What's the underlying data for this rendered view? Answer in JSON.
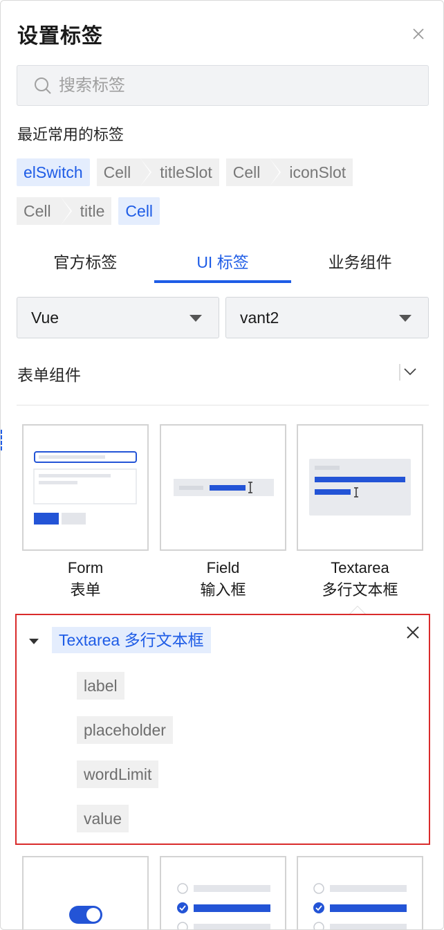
{
  "header": {
    "title": "设置标签"
  },
  "search": {
    "placeholder": "搜索标签"
  },
  "recent": {
    "title": "最近常用的标签",
    "row1": {
      "tag_a": "elSwitch",
      "pair_a": [
        "Cell",
        "titleSlot"
      ],
      "pair_b": [
        "Cell",
        "iconSlot"
      ]
    },
    "row2": {
      "pair_c": [
        "Cell",
        "title"
      ],
      "tag_b": "Cell"
    }
  },
  "tabs": [
    {
      "label": "官方标签",
      "active": false
    },
    {
      "label": "UI 标签",
      "active": true
    },
    {
      "label": "业务组件",
      "active": false
    }
  ],
  "filters": {
    "framework": "Vue",
    "library": "vant2"
  },
  "section": {
    "title": "表单组件"
  },
  "components": [
    {
      "name": "Form",
      "cn": "表单"
    },
    {
      "name": "Field",
      "cn": "输入框"
    },
    {
      "name": "Textarea",
      "cn": "多行文本框"
    }
  ],
  "detail": {
    "title": "Textarea 多行文本框",
    "props": [
      "label",
      "placeholder",
      "wordLimit",
      "value"
    ]
  },
  "colors": {
    "accent": "#1e5ce6",
    "highlight_border": "#d92b2b",
    "tag_bg": "#f0f0f0"
  },
  "icons": {
    "close": "close-icon",
    "search": "search-icon",
    "caret": "caret-down-icon",
    "chevron": "chevron-down-icon"
  }
}
